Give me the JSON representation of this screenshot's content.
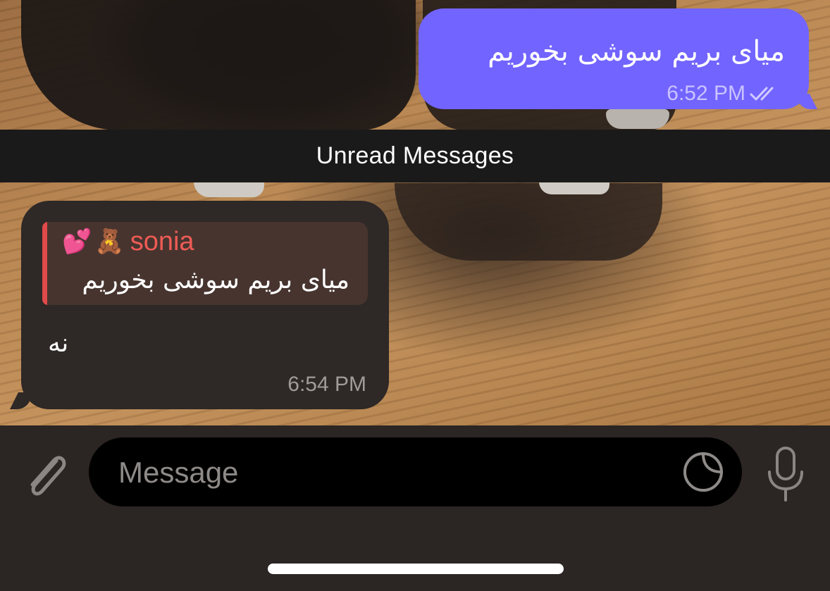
{
  "chat": {
    "outgoing_message": {
      "text": "میای بریم سوشی بخوریم",
      "time": "6:52 PM",
      "status_icon": "double-check-icon",
      "bubble_color": "#7264ff"
    },
    "unread_divider": {
      "label": "Unread Messages"
    },
    "incoming_message": {
      "reply": {
        "sender_emoji_1": "💕",
        "sender_emoji_2": "🧸",
        "sender_name": "sonia",
        "quoted_text": "میای بریم سوشی بخوریم",
        "accent_color": "#e04a4a"
      },
      "text": "نه",
      "time": "6:54 PM",
      "bubble_color": "#2e2826"
    }
  },
  "composer": {
    "placeholder": "Message",
    "value": "",
    "attach_icon": "paperclip-icon",
    "sticker_icon": "sticker-icon",
    "mic_icon": "microphone-icon"
  }
}
